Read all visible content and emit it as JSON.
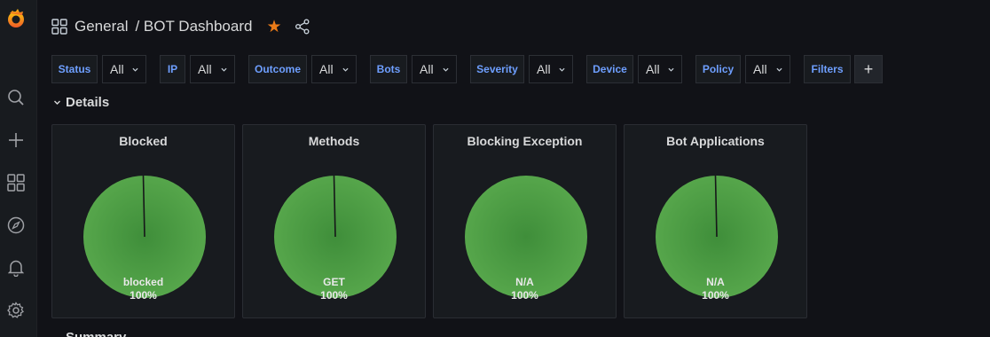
{
  "breadcrumb": {
    "folder": "General",
    "dashboard": "/ BOT Dashboard"
  },
  "variables": [
    {
      "label": "Status",
      "value": "All"
    },
    {
      "label": "IP",
      "value": "All"
    },
    {
      "label": "Outcome",
      "value": "All"
    },
    {
      "label": "Bots",
      "value": "All"
    },
    {
      "label": "Severity",
      "value": "All"
    },
    {
      "label": "Device",
      "value": "All"
    },
    {
      "label": "Policy",
      "value": "All"
    },
    {
      "label": "Filters",
      "value": "+"
    }
  ],
  "row": {
    "title": "Details"
  },
  "next_row": {
    "title": "Summary"
  },
  "panels": [
    {
      "title": "Blocked",
      "slice_label": "blocked",
      "percent": "100%"
    },
    {
      "title": "Methods",
      "slice_label": "GET",
      "percent": "100%"
    },
    {
      "title": "Blocking Exception",
      "slice_label": "N/A",
      "percent": "100%"
    },
    {
      "title": "Bot Applications",
      "slice_label": "N/A",
      "percent": "100%"
    }
  ],
  "colors": {
    "pie": "#56a64b",
    "accent": "#eb7b18",
    "label": "#6e9fff"
  },
  "icons": [
    "grafana-logo-icon",
    "search-icon",
    "plus-icon",
    "dashboards-icon",
    "explore-icon",
    "bell-icon",
    "gear-icon"
  ]
}
